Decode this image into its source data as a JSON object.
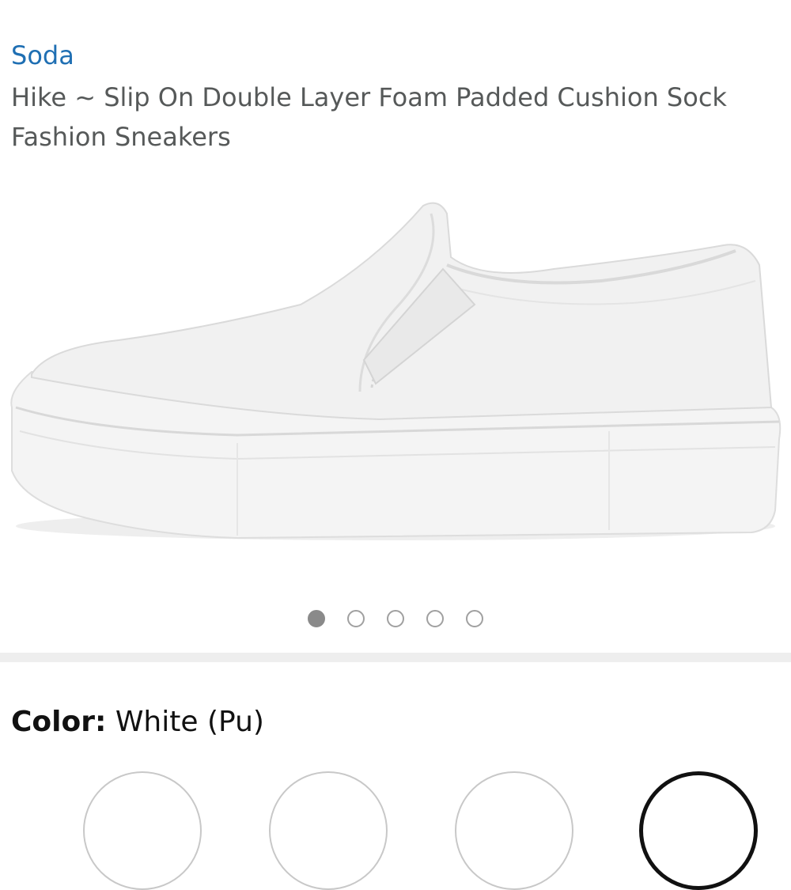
{
  "product": {
    "brand": "Soda",
    "title": "Hike ~ Slip On Double Layer Foam Padded Cushion Sock Fashion Sneakers"
  },
  "gallery": {
    "total_images": 5,
    "active_index": 0
  },
  "color": {
    "label": "Color:",
    "value": "White (Pu)"
  },
  "swatches": [
    {
      "name": "swatch-1",
      "selected": false
    },
    {
      "name": "swatch-2",
      "selected": false
    },
    {
      "name": "swatch-3",
      "selected": false
    },
    {
      "name": "swatch-4",
      "selected": true
    }
  ]
}
